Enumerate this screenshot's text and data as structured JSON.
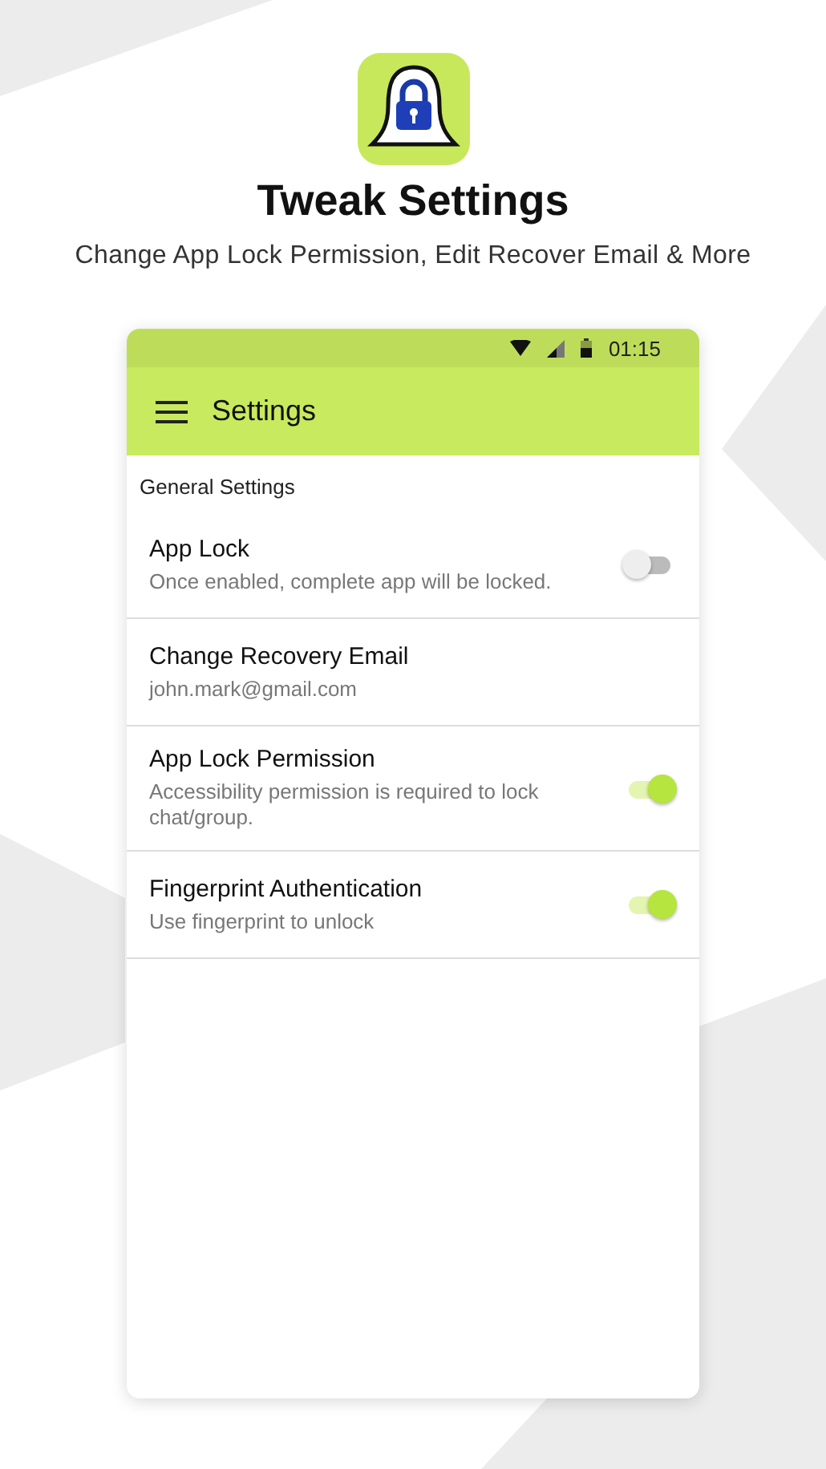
{
  "header": {
    "title": "Tweak Settings",
    "subtitle": "Change App Lock Permission, Edit Recover Email & More"
  },
  "status_bar": {
    "time": "01:15"
  },
  "toolbar": {
    "title": "Settings"
  },
  "section": {
    "title": "General Settings"
  },
  "rows": [
    {
      "kind": "switch",
      "title": "App Lock",
      "subtitle": "Once enabled, complete app will be locked.",
      "on": false
    },
    {
      "kind": "text",
      "title": "Change Recovery Email",
      "subtitle": "john.mark@gmail.com"
    },
    {
      "kind": "switch",
      "title": "App Lock Permission",
      "subtitle": "Accessibility permission is required to lock chat/group.",
      "on": true
    },
    {
      "kind": "switch",
      "title": "Fingerprint Authentication",
      "subtitle": "Use fingerprint to unlock",
      "on": true
    }
  ]
}
